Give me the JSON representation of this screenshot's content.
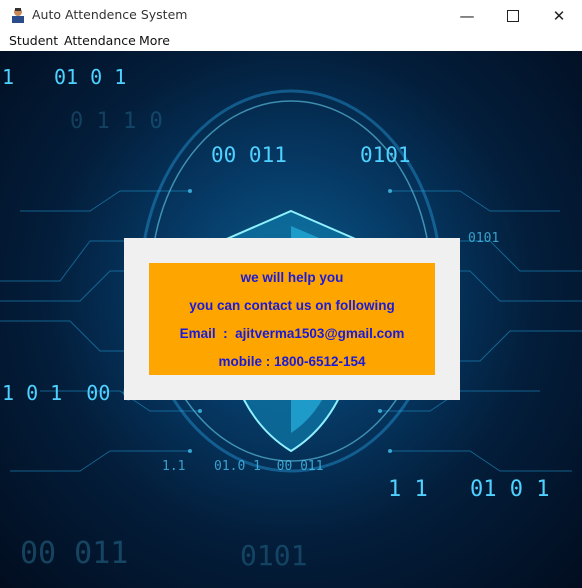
{
  "window": {
    "title": "Auto Attendence System"
  },
  "menu": {
    "items": [
      "Student",
      "Attendance",
      "More"
    ]
  },
  "contact": {
    "line1": "we will help you",
    "line2": "you can contact us on following",
    "line3": "Email  :  ajitverma1503@gmail.com",
    "line4": "mobile : 1800-6512-154"
  },
  "background": {
    "digit_strings": [
      "1",
      "01 0 1",
      "00 011",
      "0101",
      "1 0 1  00 0",
      "1 1",
      "01 0 1",
      "1.1",
      "01.0 1  00 011",
      "0101",
      "00 011",
      "0 1 1 0",
      "0101"
    ]
  },
  "colors": {
    "panel": "#ffa500",
    "text": "#1a1ad8",
    "dialog": "#f0f0f0"
  },
  "icons": [
    "app-icon",
    "minimize-icon",
    "maximize-icon",
    "close-icon",
    "shield-icon"
  ]
}
